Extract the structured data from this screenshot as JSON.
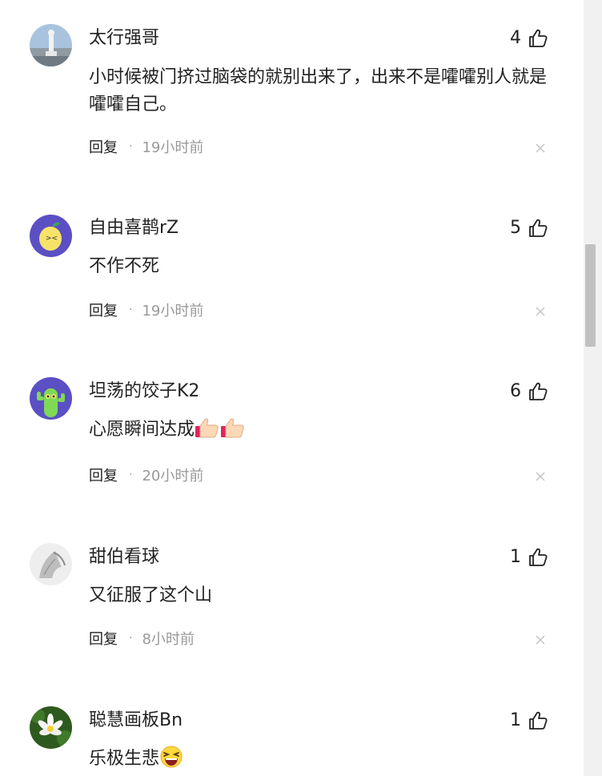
{
  "comments": [
    {
      "username": "太行强哥",
      "likes": "4",
      "text": "小时候被门挤过脑袋的就别出来了，出来不是嚯嚯别人就是嚯嚯自己。",
      "reply": "回复",
      "separator": "·",
      "time": "19小时前",
      "avatar": "statue-photo"
    },
    {
      "username": "自由喜鹊rZ",
      "likes": "5",
      "text": "不作不死",
      "reply": "回复",
      "separator": "·",
      "time": "19小时前",
      "avatar": "lemon-cartoon"
    },
    {
      "username": "坦荡的饺子K2",
      "likes": "6",
      "text": "心愿瞬间达成",
      "reply": "回复",
      "separator": "·",
      "time": "20小时前",
      "avatar": "cactus-cartoon"
    },
    {
      "username": "甜伯看球",
      "likes": "1",
      "text": "又征服了这个山",
      "reply": "回复",
      "separator": "·",
      "time": "8小时前",
      "avatar": "horse-sketch"
    },
    {
      "username": "聪慧画板Bn",
      "likes": "1",
      "text": "乐极生悲",
      "avatar": "lotus-photo"
    }
  ],
  "icons": {
    "like": "thumbs-up-icon",
    "close": "close-icon",
    "emoji_thumbs": "thumbs-up-emoji",
    "emoji_laugh": "laughing-emoji"
  },
  "colors": {
    "primary_text": "#222222",
    "secondary_text": "#999999",
    "avatar_purple": "#5b4fc4"
  }
}
